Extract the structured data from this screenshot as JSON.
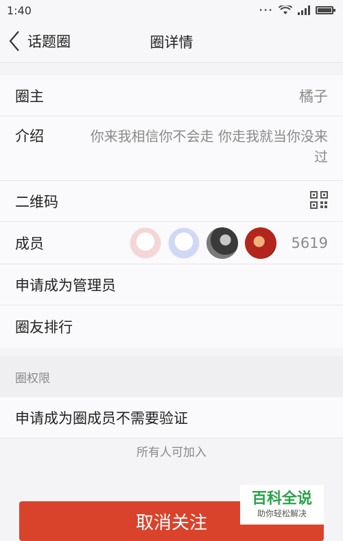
{
  "status_bar": {
    "time": "1:40",
    "icons": [
      "signal-dots-icon",
      "wifi-icon",
      "signal-icon",
      "battery-icon"
    ]
  },
  "nav": {
    "back_label": "话题圈",
    "title": "圈详情"
  },
  "details": {
    "owner_label": "圈主",
    "owner_value": "橘子",
    "intro_label": "介绍",
    "intro_line1": "你来我相信你不会走 你走我就当你没来",
    "intro_line2": "过",
    "qrcode_label": "二维码",
    "members_label": "成员",
    "members_count": "5619",
    "apply_admin_label": "申请成为管理员",
    "ranking_label": "圈友排行"
  },
  "permissions": {
    "header": "圈权限",
    "rule_label": "申请成为圈成员不需要验证",
    "note": "所有人可加入"
  },
  "actions": {
    "unfollow_label": "取消关注",
    "accent_color": "#d9432c"
  },
  "watermark": {
    "title": "百科全说",
    "subtitle": "助你轻松解决"
  }
}
